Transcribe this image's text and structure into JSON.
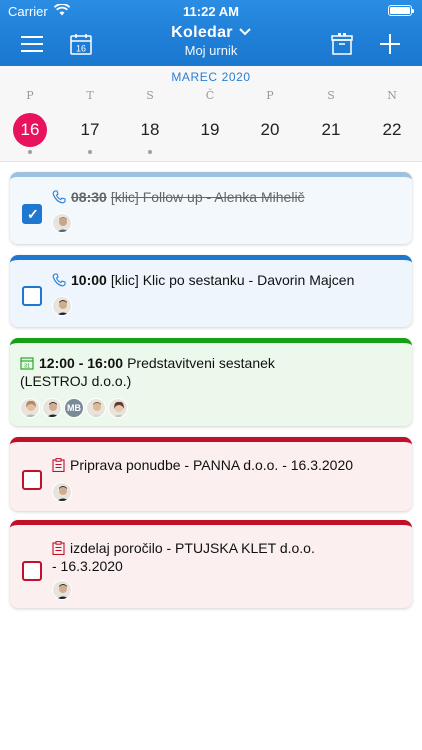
{
  "status_bar": {
    "carrier": "Carrier",
    "time": "11:22 AM"
  },
  "nav": {
    "title": "Koledar",
    "subtitle": "Moj urnik",
    "calendar_day": "16",
    "icons": {
      "menu": "hamburger-menu-icon",
      "calendar": "calendar-icon",
      "inbox": "archive-box-icon",
      "add": "plus-icon"
    }
  },
  "calendar": {
    "month": "MAREC 2020",
    "weekdays": [
      "P",
      "T",
      "S",
      "Č",
      "P",
      "S",
      "N"
    ],
    "days": [
      "16",
      "17",
      "18",
      "19",
      "20",
      "21",
      "22"
    ],
    "selected_day": "16",
    "days_with_events": [
      "16",
      "17",
      "18"
    ],
    "accent_color": "#e8125d"
  },
  "events": [
    {
      "time": "08:30",
      "title": "[klic] Follow up - Alenka Mihelič",
      "type": "call",
      "done": true,
      "color": "#9dc1de",
      "bg": "#f3f8fd"
    },
    {
      "time": "10:00",
      "title": "[klic] Klic po sestanku - Davorin Majcen",
      "type": "call",
      "done": false,
      "color": "#1f78cf",
      "bg": "#eef5fc"
    },
    {
      "time": "12:00 - 16:00",
      "title": "Predstavitveni sestanek",
      "title2": "(LESTROJ d.o.o.)",
      "type": "meeting",
      "calendar_icon_day": "31",
      "color": "#16a016",
      "bg": "#edf8ed",
      "avatar_initials": "MB"
    },
    {
      "title": "Priprava ponudbe - PANNA d.o.o. - 16.3.2020",
      "type": "task",
      "done": false,
      "color": "#c0102a",
      "bg": "#fbefef"
    },
    {
      "title": "izdelaj poročilo - PTUJSKA KLET d.o.o.",
      "title2": "- 16.3.2020",
      "type": "task",
      "done": false,
      "color": "#c0102a",
      "bg": "#fbefef"
    }
  ]
}
